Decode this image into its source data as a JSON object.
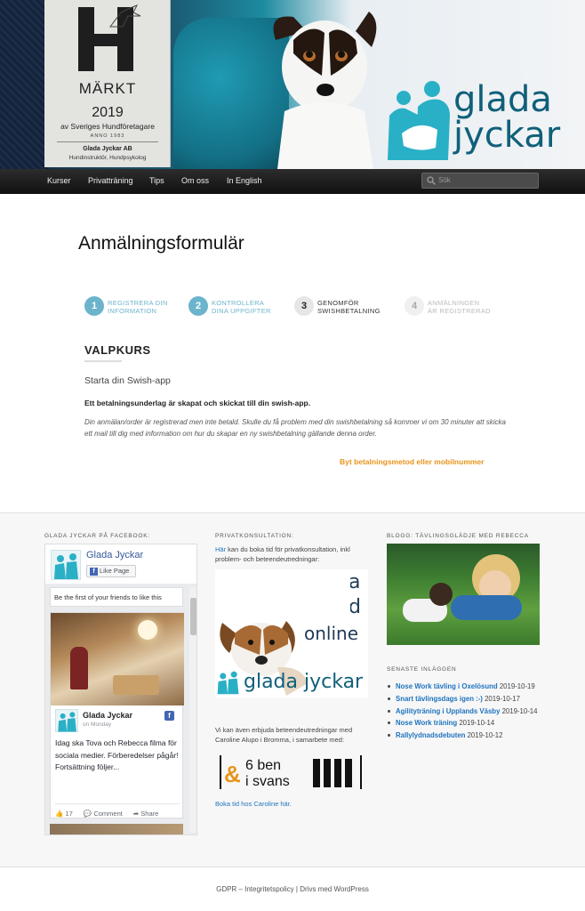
{
  "banner": {
    "badge_marked": "MÄRKT",
    "badge_year": "2019",
    "badge_org": "av Sveriges Hundföretagare",
    "badge_anno": "ANNO 1983",
    "badge_company": "Glada Jyckar AB",
    "badge_roles": "Hundinstruktör, Hundpsykolog",
    "logo_line1": "glada",
    "logo_line2": "jyckar",
    "brand_color": "#10607a"
  },
  "nav": {
    "items": [
      "Kurser",
      "Privatträning",
      "Tips",
      "Om oss",
      "In English"
    ],
    "search_placeholder": "Sök"
  },
  "main": {
    "title": "Anmälningsformulär",
    "steps": [
      {
        "num": "1",
        "line1": "Registrera din",
        "line2": "information",
        "state": "done"
      },
      {
        "num": "2",
        "line1": "Kontrollera",
        "line2": "dina uppgifter",
        "state": "done"
      },
      {
        "num": "3",
        "line1": "Genomför",
        "line2": "Swishbetalning",
        "state": "active"
      },
      {
        "num": "4",
        "line1": "Anmälningen",
        "line2": "är registrerad",
        "state": "todo"
      }
    ],
    "course": "VALPKURS",
    "swish_heading": "Starta din Swish-app",
    "swish_bold": "Ett betalningsunderlag är skapat och skickat till din swish-app.",
    "swish_note": "Din anmälan/order är registrerad men inte betald. Skulle du få problem med din swishbetalning så kommer vi om 30 minuter att skicka ett mail till dig med information om hur du skapar en ny swishbetalning gällande denna order.",
    "change_link": "Byt betalningsmetod eller mobilnummer",
    "accent": "#e8941a",
    "step_color": "#6cb4cc"
  },
  "widgets": {
    "facebook": {
      "title": "GLADA JYCKAR PÅ FACEBOOK:",
      "page_name": "Glada Jyckar",
      "like_label": "Like Page",
      "friends_text": "Be the first of your friends to like this",
      "post_author": "Glada Jyckar",
      "post_time": "on Monday",
      "post_text": "Idag ska Tova och Rebecca filma för sociala medier. Förberedelser pågår! Fortsättning följer...",
      "likes": "17",
      "comment_label": "Comment",
      "share_label": "Share"
    },
    "private": {
      "title": "PRIVATKONSULTATION:",
      "intro_link": "Här",
      "intro_text": " kan du boka tid för privatkonsultation, inkl problem- och beteendeutredningar:",
      "ad_partial1": "a",
      "ad_partial2": "d",
      "ad_online": "online",
      "ad_logo": "glada jyckar",
      "extra_text": "Vi kan även erbjuda beteendeutredningar med Caroline Alupo i Bromma, i samarbete med:",
      "partner_logo_amp": "&",
      "partner_logo_line1": "6 ben",
      "partner_logo_line2": "i svans",
      "book_link": "Boka tid hos Caroline här."
    },
    "blog": {
      "title": "BLOGG: TÄVLINGSGLÄDJE MED REBECCA",
      "recent_title": "SENASTE INLÄGGEN",
      "posts": [
        {
          "title": "Nose Work tävling i Oxelösund",
          "date": "2019-10-19"
        },
        {
          "title": "Snart tävlingsdags igen :-)",
          "date": "2019-10-17"
        },
        {
          "title": "Agilityträning i Upplands Väsby",
          "date": "2019-10-14"
        },
        {
          "title": "Nose Work träning",
          "date": "2019-10-14"
        },
        {
          "title": "Rallylydnadsdebuten",
          "date": "2019-10-12"
        }
      ]
    }
  },
  "footer": {
    "gdpr": "GDPR – Integritetspolicy",
    "separator": "|",
    "powered": "Drivs med WordPress"
  }
}
